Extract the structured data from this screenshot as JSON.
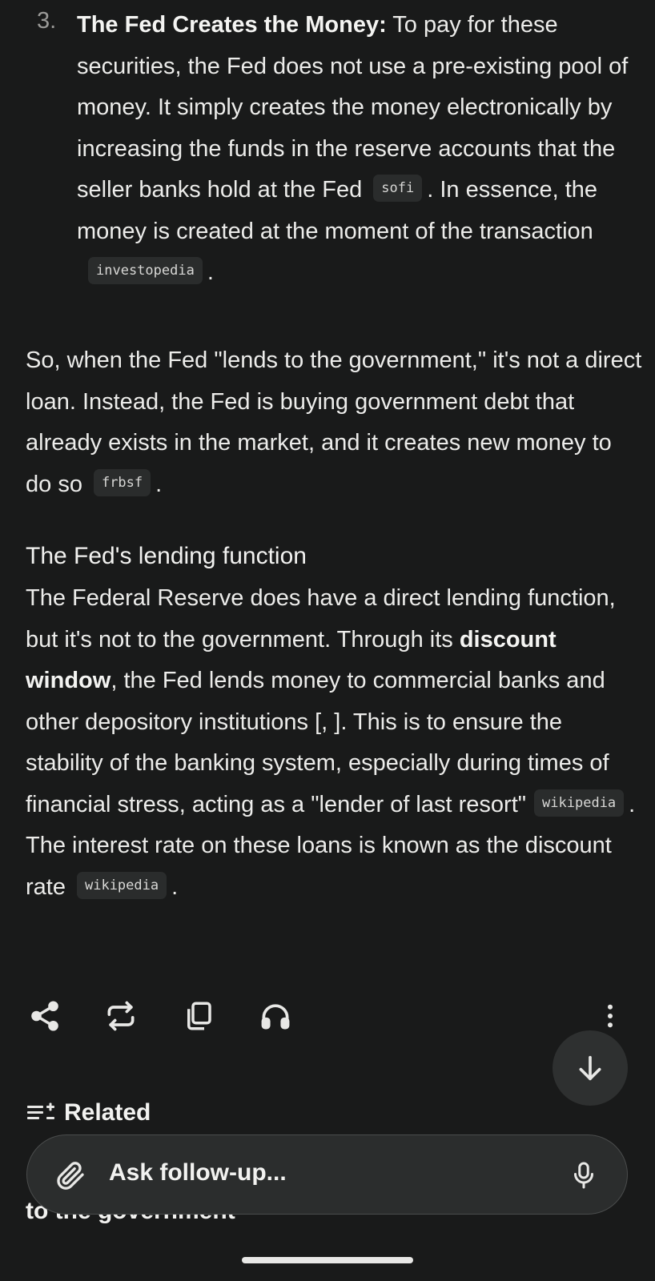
{
  "list_item": {
    "number": "3.",
    "title": "The Fed Creates the Money:",
    "text_a": " To pay for these securities, the Fed does not use a pre-existing pool of money. It simply creates the money electronically by increasing the funds in the reserve accounts that the seller banks hold at the Fed",
    "cite_a": "sofi",
    "text_b": ". In essence, the money is created at the moment of the transaction",
    "cite_b": "investopedia",
    "text_c": "."
  },
  "para1": {
    "text": "So, when the Fed \"lends to the government,\" it's not a direct loan. Instead, the Fed is buying government debt that already exists in the market, and it creates new money to do so",
    "cite": "frbsf",
    "end": "."
  },
  "heading": "The Fed's lending function",
  "para2": {
    "text_a": "The Federal Reserve does have a direct lending function, but it's not to the government. Through its ",
    "bold": "discount window",
    "text_b": ", the Fed lends money to commercial banks and other depository institutions [, ]. This is to ensure the stability of the banking system, especially during times of financial stress, acting as a \"lender of last resort\"",
    "cite_a": "wikipedia",
    "text_c": ". The interest rate on these loans is known as the discount rate",
    "cite_b": "wikipedia",
    "text_d": "."
  },
  "actions": {
    "icons": [
      "share-icon",
      "rewrite-icon",
      "copy-icon",
      "headphones-icon",
      "more-icon"
    ]
  },
  "related": {
    "label": "Related"
  },
  "related_first_item": "to the government",
  "input": {
    "placeholder": "Ask follow-up..."
  }
}
